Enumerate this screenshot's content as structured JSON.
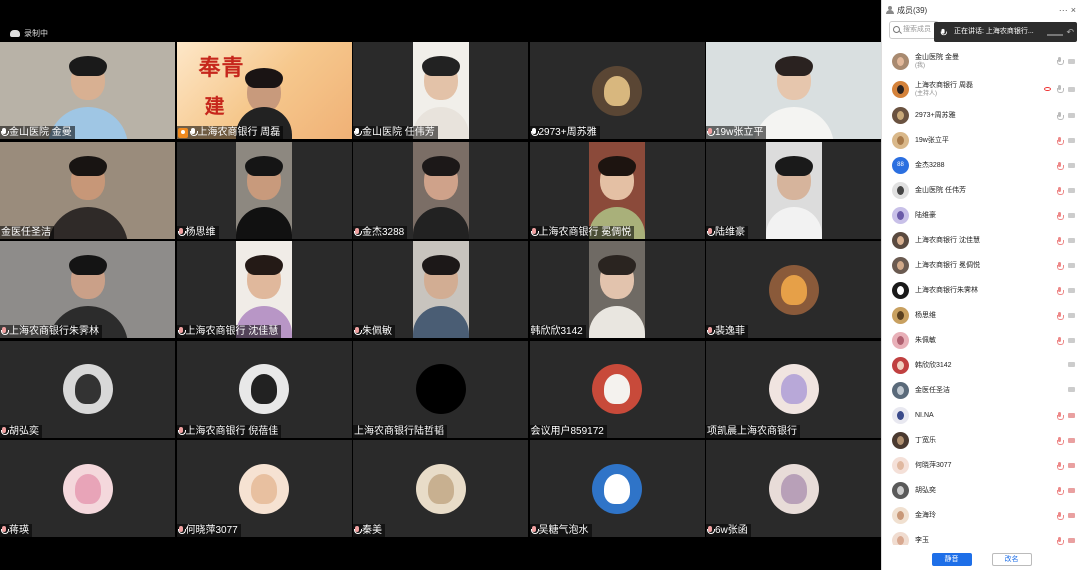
{
  "recording": {
    "label": "录制中"
  },
  "tiles": [
    {
      "name": "金山医院 金曼",
      "mic": "on",
      "kind": "video",
      "bg": "#b8b2a7",
      "skin": "#d8b092",
      "hair": "#1a1a1a",
      "shirt": "#9fc6e4"
    },
    {
      "name": "上海农商银行 周磊",
      "mic": "on",
      "kind": "banner",
      "host": true,
      "active": true,
      "banner_line1": "奉青",
      "banner_line2": "建"
    },
    {
      "name": "金山医院 任伟芳",
      "mic": "on",
      "kind": "narrow",
      "bg": "#f1efea",
      "skin": "#e3c2a8",
      "hair": "#222",
      "shirt": "#e8e3dc"
    },
    {
      "name": "2973+周苏雅",
      "mic": "on",
      "kind": "avatar",
      "avatar_bg": "#5a4634",
      "avatar_fg": "#d8b77e"
    },
    {
      "name": "19w张立平",
      "mic": "muted",
      "kind": "video",
      "bg": "#d9dfe0",
      "skin": "#e6c6ad",
      "hair": "#2a2220",
      "shirt": "#f4f4f2"
    },
    {
      "name": "金医任圣洁",
      "mic": "none",
      "kind": "video",
      "bg": "#9a8c7c",
      "skin": "#c79778",
      "hair": "#181412",
      "shirt": "#2f2a28"
    },
    {
      "name": "杨思维",
      "mic": "muted",
      "kind": "narrow",
      "bg": "#8d8880",
      "skin": "#c89a7c",
      "hair": "#151515",
      "shirt": "#111"
    },
    {
      "name": "金杰3288",
      "mic": "muted",
      "kind": "narrow",
      "bg": "#7b6e66",
      "skin": "#cfa28a",
      "hair": "#1c1818",
      "shirt": "#222"
    },
    {
      "name": "上海农商银行 冕倜悦",
      "mic": "muted",
      "kind": "narrow",
      "bg": "#8b4a3a",
      "skin": "#e4c0a4",
      "hair": "#1d1410",
      "shirt": "#a9b07a"
    },
    {
      "name": "陆维豪",
      "mic": "muted",
      "kind": "narrow",
      "bg": "#dcdcdc",
      "skin": "#d6b49c",
      "hair": "#1a1a1a",
      "shirt": "#f2f2f2"
    },
    {
      "name": "上海农商银行朱霁林",
      "mic": "muted",
      "kind": "video",
      "bg": "#8e8c8a",
      "skin": "#caa088",
      "hair": "#141414",
      "shirt": "#2c2c2c"
    },
    {
      "name": "上海农商银行 沈佳慧",
      "mic": "muted",
      "kind": "narrow",
      "bg": "#f0ece7",
      "skin": "#e0b89c",
      "hair": "#241a16",
      "shirt": "#b896c6"
    },
    {
      "name": "朱佩敏",
      "mic": "muted",
      "kind": "narrow",
      "bg": "#c8c4be",
      "skin": "#d2ad93",
      "hair": "#1c1818",
      "shirt": "#4a5d74"
    },
    {
      "name": "韩欣欣3142",
      "mic": "none",
      "kind": "narrow",
      "bg": "#6f6a64",
      "skin": "#e2c3ad",
      "hair": "#2a2420",
      "shirt": "#e9e6e0"
    },
    {
      "name": "裴逸菲",
      "mic": "muted",
      "kind": "avatar",
      "avatar_bg": "#8a5a3a",
      "avatar_fg": "#e6a048"
    },
    {
      "name": "胡弘奕",
      "mic": "muted",
      "kind": "avatar",
      "avatar_bg": "#d8d8d8",
      "avatar_fg": "#333"
    },
    {
      "name": "上海农商银行 倪蓓佳",
      "mic": "muted",
      "kind": "avatar",
      "avatar_bg": "#e8e8e8",
      "avatar_fg": "#222"
    },
    {
      "name": "上海农商银行陆哲韬",
      "mic": "none",
      "kind": "avatar",
      "avatar_bg": "#000",
      "avatar_fg": "#000"
    },
    {
      "name": "会议用户859172",
      "mic": "none",
      "kind": "avatar",
      "avatar_bg": "#c84a3a",
      "avatar_fg": "#f4f2ee"
    },
    {
      "name": "项凯晨上海农商银行",
      "mic": "none",
      "kind": "avatar",
      "avatar_bg": "#f0e4e0",
      "avatar_fg": "#b8a8d8"
    },
    {
      "name": "蒋瑛",
      "mic": "muted",
      "kind": "avatar",
      "avatar_bg": "#f4d8dc",
      "avatar_fg": "#e8a4b8"
    },
    {
      "name": "何晓萍3077",
      "mic": "muted",
      "kind": "avatar",
      "avatar_bg": "#f6e2d2",
      "avatar_fg": "#e8c0a0"
    },
    {
      "name": "秦美",
      "mic": "muted",
      "kind": "avatar",
      "avatar_bg": "#e8dcc8",
      "avatar_fg": "#c8b090"
    },
    {
      "name": "吴糖气泡水",
      "mic": "muted",
      "kind": "avatar",
      "avatar_bg": "#2f74c8",
      "avatar_fg": "#fff"
    },
    {
      "name": "6w张函",
      "mic": "muted",
      "kind": "avatar",
      "avatar_bg": "#e8dcd8",
      "avatar_fg": "#b8a0b8"
    }
  ],
  "sidebar": {
    "title": "成员(39)",
    "search_placeholder": "搜索成员",
    "speaking_label": "正在讲话: 上海农商银行...",
    "more_label": "···",
    "close_label": "×",
    "back_label": "↶",
    "members": [
      {
        "name": "金山医院 金曼",
        "sub": "(我)",
        "avatar": "#a88a70",
        "fg": "#e2b89a",
        "mic": "on",
        "cam": "on"
      },
      {
        "name": "上海农商银行 周磊",
        "sub": "(主持人)",
        "avatar": "#d4823a",
        "fg": "#2a2220",
        "mic": "on",
        "cam": "on",
        "eye": true
      },
      {
        "name": "2973+周苏雅",
        "avatar": "#6a5240",
        "fg": "#c8a878",
        "mic": "on",
        "cam": "on"
      },
      {
        "name": "19w张立平",
        "avatar": "#d9b88a",
        "fg": "#a87a4a",
        "mic": "muted",
        "cam": "on"
      },
      {
        "name": "金杰3288",
        "avatar_text": "88",
        "mic": "muted",
        "cam": "on"
      },
      {
        "name": "金山医院 任伟芳",
        "avatar": "#e0e0e0",
        "fg": "#444",
        "mic": "muted",
        "cam": "on"
      },
      {
        "name": "陆维豪",
        "avatar": "#c8c0e8",
        "fg": "#6a5aa8",
        "mic": "muted",
        "cam": "on"
      },
      {
        "name": "上海农商银行 沈佳慧",
        "avatar": "#5a4a40",
        "fg": "#d8b090",
        "mic": "muted",
        "cam": "on"
      },
      {
        "name": "上海农商银行 冕倜悦",
        "avatar": "#6a5a50",
        "fg": "#d0a888",
        "mic": "muted",
        "cam": "on"
      },
      {
        "name": "上海农商银行朱霁林",
        "avatar": "#1a1a1a",
        "fg": "#fff",
        "mic": "muted",
        "cam": "on"
      },
      {
        "name": "杨思维",
        "avatar": "#c8a060",
        "fg": "#5a4020",
        "mic": "muted",
        "cam": "on"
      },
      {
        "name": "朱佩敏",
        "avatar": "#e8b0b8",
        "fg": "#b06070",
        "mic": "muted",
        "cam": "on"
      },
      {
        "name": "韩欣欣3142",
        "avatar": "#c04040",
        "fg": "#f0d0c0",
        "mic": "none",
        "cam": "on"
      },
      {
        "name": "金医任圣洁",
        "avatar": "#5a6a7a",
        "fg": "#c0c8d0",
        "mic": "none",
        "cam": "on"
      },
      {
        "name": "NI.NA",
        "avatar": "#e8e8f0",
        "fg": "#3a4a8a",
        "mic": "muted",
        "cam": "off"
      },
      {
        "name": "丁宽乐",
        "avatar": "#4a3a30",
        "fg": "#b09070",
        "mic": "muted",
        "cam": "off"
      },
      {
        "name": "何晓萍3077",
        "avatar": "#f4e0d8",
        "fg": "#e0b8a0",
        "mic": "muted",
        "cam": "off"
      },
      {
        "name": "胡弘奕",
        "avatar": "#5a5a5a",
        "fg": "#cccccc",
        "mic": "muted",
        "cam": "off"
      },
      {
        "name": "金海玲",
        "avatar": "#f0e0d0",
        "fg": "#c89878",
        "mic": "muted",
        "cam": "off"
      },
      {
        "name": "李玉",
        "avatar": "#f0dcd0",
        "fg": "#d8a890",
        "mic": "muted",
        "cam": "off"
      }
    ],
    "mute_all_label": "静音",
    "rename_label": "改名"
  }
}
